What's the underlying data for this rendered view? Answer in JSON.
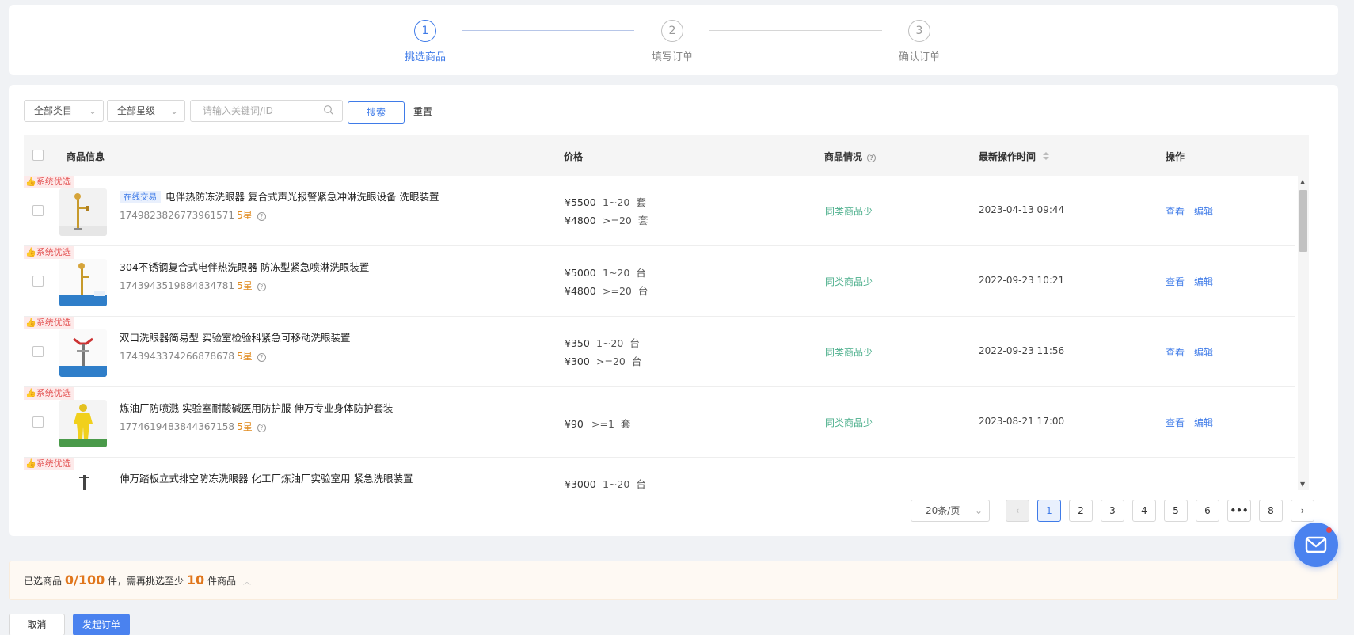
{
  "steps": [
    {
      "num": "1",
      "label": "挑选商品",
      "active": true
    },
    {
      "num": "2",
      "label": "填写订单",
      "active": false
    },
    {
      "num": "3",
      "label": "确认订单",
      "active": false
    }
  ],
  "filters": {
    "category": "全部类目",
    "level": "全部星级",
    "search_placeholder": "请输入关键词/ID",
    "search_button": "搜索",
    "reset_button": "重置"
  },
  "table": {
    "headers": {
      "info": "商品信息",
      "price": "价格",
      "condition": "商品情况",
      "time": "最新操作时间",
      "ops": "操作"
    },
    "badge": "系统优选",
    "view_label": "查看",
    "edit_label": "编辑",
    "rows": [
      {
        "tag": "在线交易",
        "title": "电伴热防冻洗眼器 复合式声光报警紧急冲淋洗眼设备 洗眼装置",
        "id": "1749823826773961571",
        "star": "5星",
        "prices": [
          {
            "price": "¥5500",
            "range": "1~20",
            "unit": "套"
          },
          {
            "price": "¥4800",
            "range": ">=20",
            "unit": "套"
          }
        ],
        "status": "同类商品少",
        "time": "2023-04-13 09:44"
      },
      {
        "tag": "",
        "title": "304不锈钢复合式电伴热洗眼器 防冻型紧急喷淋洗眼装置",
        "id": "1743943519884834781",
        "star": "5星",
        "prices": [
          {
            "price": "¥5000",
            "range": "1~20",
            "unit": "台"
          },
          {
            "price": "¥4800",
            "range": ">=20",
            "unit": "台"
          }
        ],
        "status": "同类商品少",
        "time": "2022-09-23 10:21"
      },
      {
        "tag": "",
        "title": "双口洗眼器简易型 实验室检验科紧急可移动洗眼装置",
        "id": "1743943374266878678",
        "star": "5星",
        "prices": [
          {
            "price": "¥350",
            "range": "1~20",
            "unit": "台"
          },
          {
            "price": "¥300",
            "range": ">=20",
            "unit": "台"
          }
        ],
        "status": "同类商品少",
        "time": "2022-09-23 11:56"
      },
      {
        "tag": "",
        "title": "炼油厂防喷溅 实验室耐酸碱医用防护服 伸万专业身体防护套装",
        "id": "1774619483844367158",
        "star": "5星",
        "prices": [
          {
            "price": "¥90",
            "range": ">=1",
            "unit": "套"
          }
        ],
        "status": "同类商品少",
        "time": "2023-08-21 17:00"
      },
      {
        "tag": "",
        "title": "伸万踏板立式排空防冻洗眼器 化工厂炼油厂实验室用 紧急洗眼装置",
        "id": "",
        "star": "",
        "prices": [
          {
            "price": "¥3000",
            "range": "1~20",
            "unit": "台"
          }
        ],
        "status": "",
        "time": ""
      }
    ]
  },
  "pagination": {
    "page_size": "20条/页",
    "pages": [
      "1",
      "2",
      "3",
      "4",
      "5",
      "6",
      "•••",
      "8"
    ],
    "current": "1"
  },
  "summary": {
    "prefix": "已选商品",
    "selected": "0/100",
    "unit1": "件，需再挑选至少",
    "min": "10",
    "unit2": "件商品"
  },
  "actions": {
    "cancel": "取消",
    "submit": "发起订单"
  }
}
